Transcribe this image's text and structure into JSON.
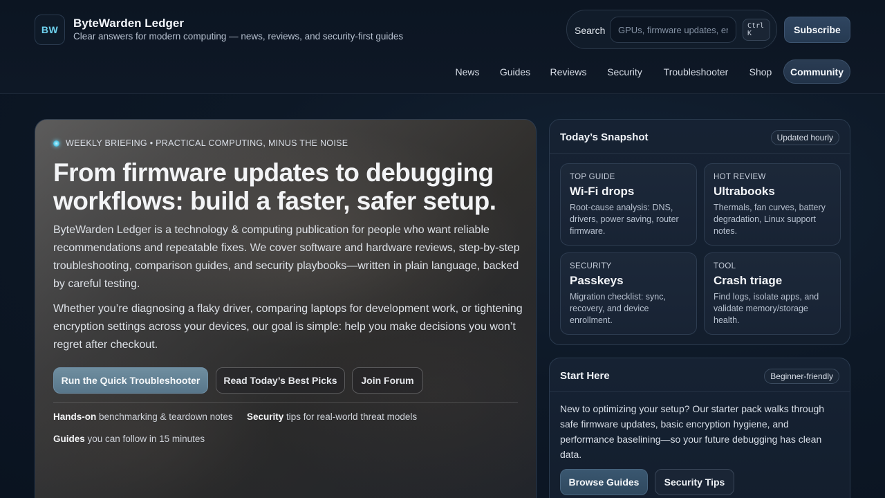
{
  "brand": {
    "logo": "BW",
    "title": "ByteWarden Ledger",
    "tagline": "Clear answers for modern computing — news, reviews, and security-first guides"
  },
  "search": {
    "label": "Search",
    "placeholder": "GPUs, firmware updates, error codes",
    "shortcut": "Ctrl K"
  },
  "header": {
    "subscribe_label": "Subscribe"
  },
  "nav": {
    "items": [
      "News",
      "Guides",
      "Reviews",
      "Security",
      "Troubleshooter",
      "Shop",
      "Community"
    ],
    "active": "Community"
  },
  "hero": {
    "eyebrow": "WEEKLY BRIEFING • PRACTICAL COMPUTING, MINUS THE NOISE",
    "title": "From firmware updates to debugging workflows: build a faster, safer setup.",
    "p1": "ByteWarden Ledger is a technology & computing publication for people who want reliable recommendations and repeatable fixes. We cover software and hardware reviews, step-by-step troubleshooting, comparison guides, and security playbooks—written in plain language, backed by careful testing.",
    "p2": "Whether you’re diagnosing a flaky driver, comparing laptops for development work, or tightening encryption settings across your devices, our goal is simple: help you make decisions you won’t regret after checkout.",
    "buttons": {
      "primary": "Run the Quick Troubleshooter",
      "picks": "Read Today’s Best Picks",
      "forum": "Join Forum"
    },
    "features": [
      {
        "bold": "Hands-on",
        "text": " benchmarking & teardown notes"
      },
      {
        "bold": "Security",
        "text": " tips for real-world threat models"
      },
      {
        "bold": "Guides",
        "text": " you can follow in 15 minutes"
      }
    ]
  },
  "snapshot": {
    "title": "Today’s Snapshot",
    "badge": "Updated hourly",
    "tiles": [
      {
        "kicker": "TOP GUIDE",
        "title": "Wi-Fi drops",
        "text": "Root-cause analysis: DNS, drivers, power saving, router firmware."
      },
      {
        "kicker": "HOT REVIEW",
        "title": "Ultrabooks",
        "text": "Thermals, fan curves, battery degradation, Linux support notes."
      },
      {
        "kicker": "SECURITY",
        "title": "Passkeys",
        "text": "Migration checklist: sync, recovery, and device enrollment."
      },
      {
        "kicker": "TOOL",
        "title": "Crash triage",
        "text": "Find logs, isolate apps, and validate memory/storage health."
      }
    ]
  },
  "start": {
    "title": "Start Here",
    "badge": "Beginner-friendly",
    "text": "New to optimizing your setup? Our starter pack walks through safe firmware updates, basic encryption hygiene, and performance baselining—so your future debugging has clean data.",
    "buttons": {
      "primary": "Browse Guides",
      "secondary": "Security Tips"
    }
  }
}
